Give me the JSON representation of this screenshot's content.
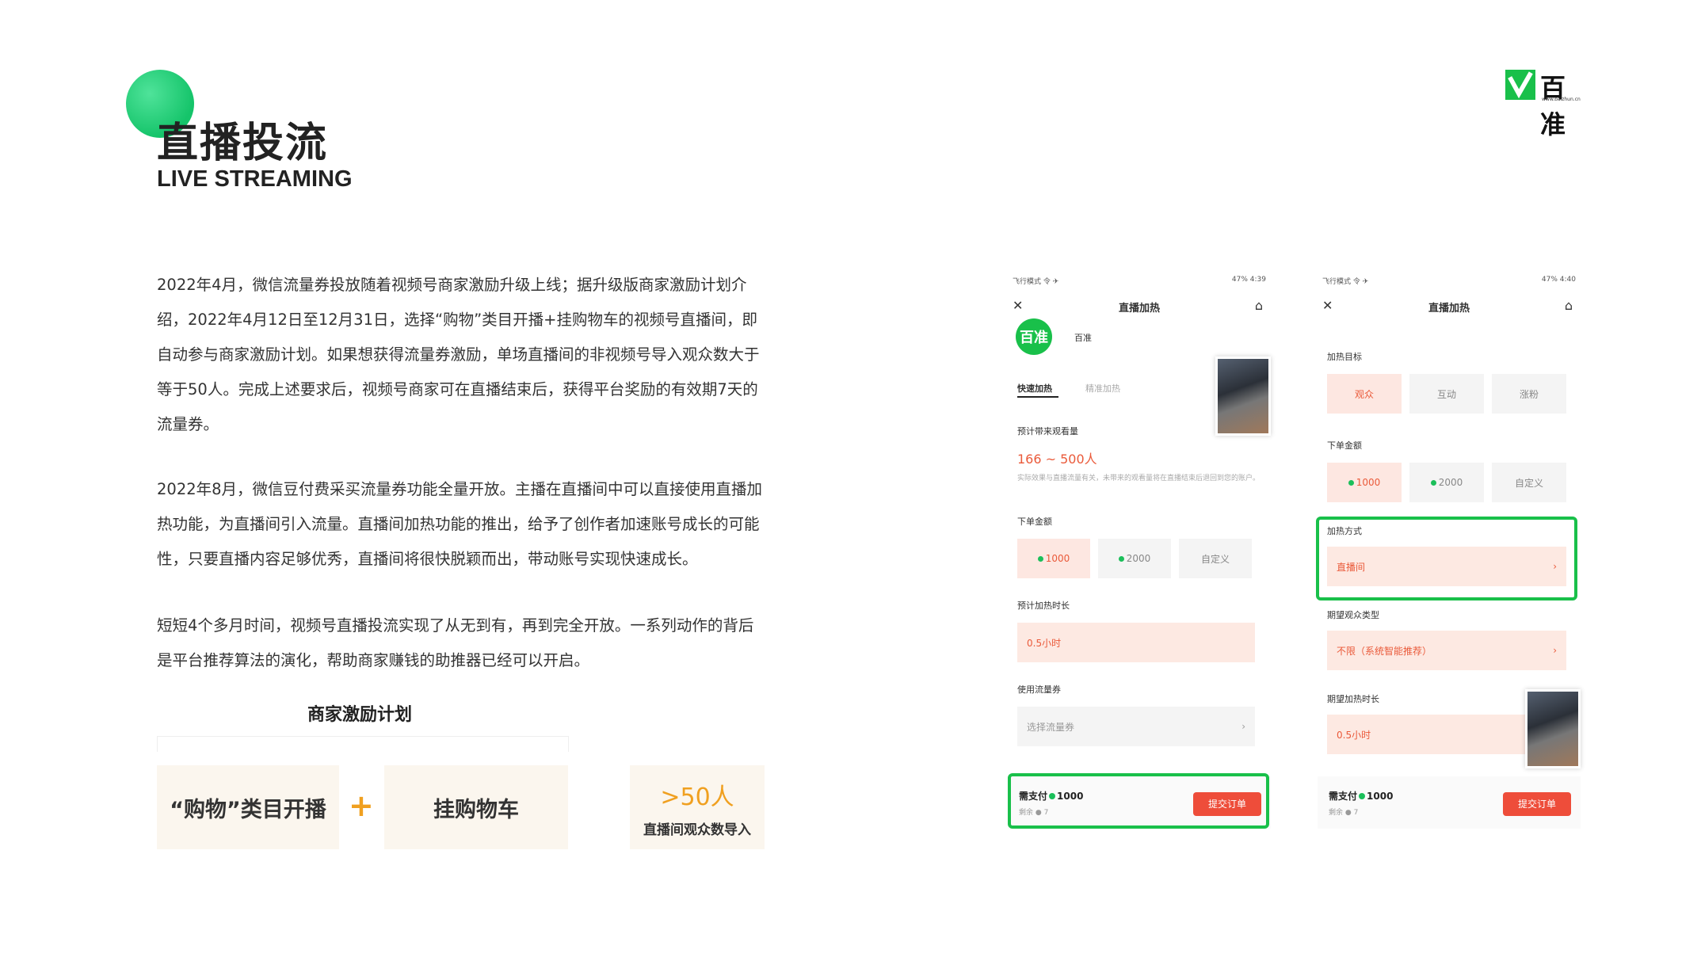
{
  "header": {
    "title_cn": "直播投流",
    "title_en": "LIVE STREAMING"
  },
  "brand": {
    "name": "百准",
    "url": "www.baizhun.cn",
    "color": "#19c04a"
  },
  "paragraphs": [
    "2022年4月，微信流量券投放随着视频号商家激励升级上线；据升级版商家激励计划介绍，2022年4月12日至12月31日，选择“购物”类目开播+挂购物车的视频号直播间，即自动参与商家激励计划。如果想获得流量券激励，单场直播间的非视频号导入观众数大于等于50人。完成上述要求后，视频号商家可在直播结束后，获得平台奖励的有效期7天的流量券。",
    "2022年8月，微信豆付费采买流量券功能全量开放。主播在直播间中可以直接使用直播加热功能，为直播间引入流量。直播间加热功能的推出，给予了创作者加速账号成长的可能性，只要直播内容足够优秀，直播间将很快脱颖而出，带动账号实现快速成长。",
    "短短4个多月时间，视频号直播投流实现了从无到有，再到完全开放。一系列动作的背后是平台推荐算法的演化，帮助商家赚钱的助推器已经可以开启。"
  ],
  "plan": {
    "title": "商家激励计划",
    "item1": "“购物”类目开播",
    "plus": "+",
    "item2": "挂购物车",
    "threshold": ">50人",
    "threshold_desc": "直播间观众数导入"
  },
  "phone1": {
    "status_left": "飞行模式 令 ✈",
    "status_right": "47% 4:39",
    "nav_title": "直播加热",
    "account_logo": "百准",
    "account_name": "百准",
    "tab_quick": "快速加热",
    "tab_precise": "精准加热",
    "est_label": "预计带来观看量",
    "est_value": "166 ~ 500人",
    "est_note": "实际效果与直播流量有关，未带来的观看量将在直播结束后退回到您的账户。",
    "amount_label": "下单金额",
    "amounts": [
      "1000",
      "2000",
      "自定义"
    ],
    "duration_label": "预计加热时长",
    "duration_value": "0.5小时",
    "coupon_label": "使用流量券",
    "coupon_placeholder": "选择流量券",
    "pay_label": "需支付",
    "pay_amount": "1000",
    "remain": "剩余 ● 7",
    "submit": "提交订单"
  },
  "phone2": {
    "status_left": "飞行模式 令 ✈",
    "status_right": "47% 4:40",
    "nav_title": "直播加热",
    "target_label": "加热目标",
    "targets": [
      "观众",
      "互动",
      "涨粉"
    ],
    "amount_label": "下单金额",
    "amounts": [
      "1000",
      "2000",
      "自定义"
    ],
    "method_label": "加热方式",
    "method_value": "直播间",
    "audience_label": "期望观众类型",
    "audience_value": "不限（系统智能推荐）",
    "duration_label": "期望加热时长",
    "duration_value": "0.5小时",
    "pay_label": "需支付",
    "pay_amount": "1000",
    "remain": "剩余 ● 7",
    "submit": "提交订单"
  }
}
